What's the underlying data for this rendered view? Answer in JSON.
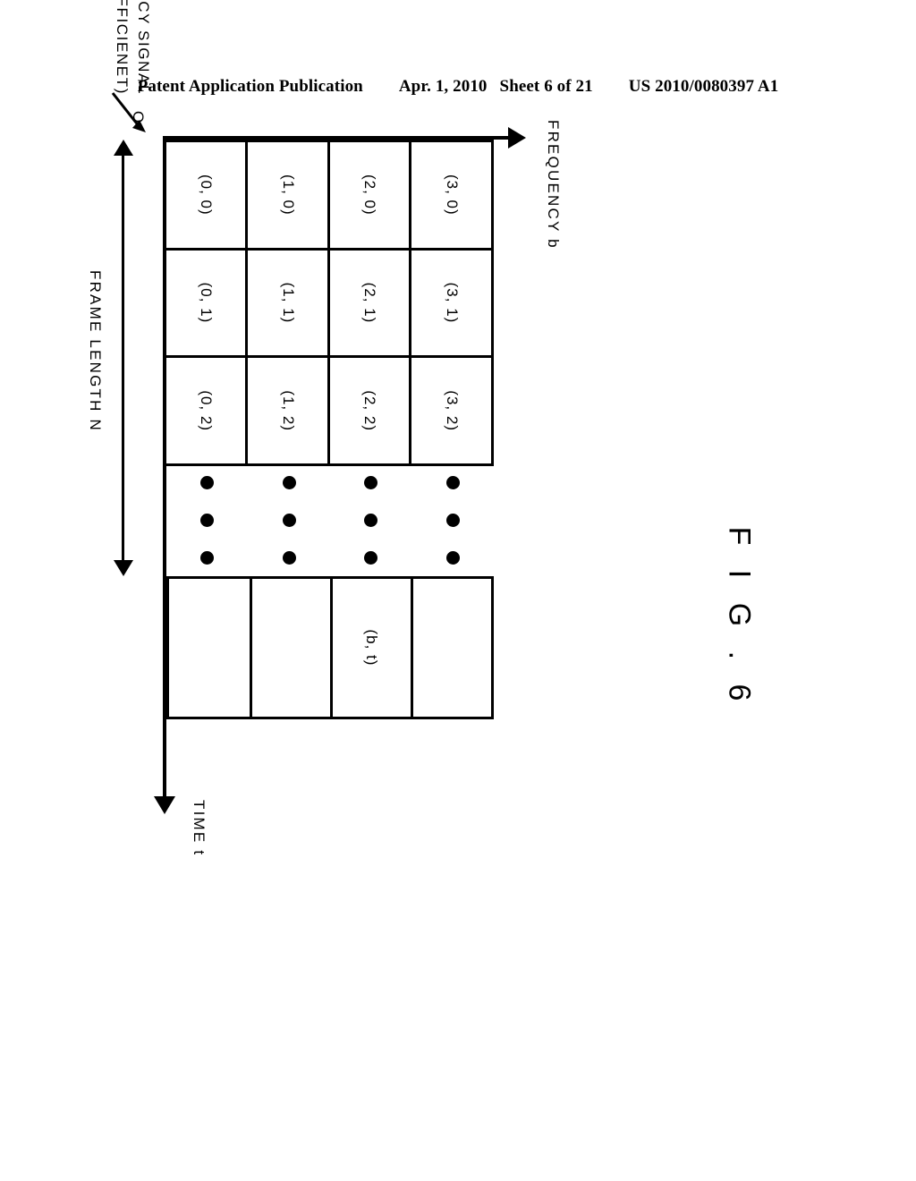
{
  "header": {
    "publication": "Patent Application Publication",
    "date": "Apr. 1, 2010",
    "sheet": "Sheet 6 of 21",
    "patent_number": "US 2010/0080397 A1"
  },
  "figure": {
    "label": "F I G .  6",
    "axes": {
      "time_label": "TIME t",
      "frequency_label": "FREQUENCY b",
      "origin_label": "O",
      "frame_length_label": "FRAME LENGTH N"
    },
    "callout": {
      "line1": "TIME-FREQUENCY SIGNAL",
      "line2": "(QMF COEFFICIENET)"
    },
    "grid": {
      "bands": [
        "3",
        "2",
        "1",
        "0"
      ],
      "time_slots": [
        "0",
        "1",
        "2"
      ],
      "cells": [
        [
          "(3, 0)",
          "(3, 1)",
          "(3, 2)"
        ],
        [
          "(2, 0)",
          "(2, 1)",
          "(2, 2)"
        ],
        [
          "(1, 0)",
          "(1, 1)",
          "(1, 2)"
        ],
        [
          "(0, 0)",
          "(0, 1)",
          "(0, 2)"
        ]
      ],
      "far_column": [
        "",
        "(b, t)",
        "",
        ""
      ],
      "ellipsis_dot_columns": 3,
      "ellipsis_dot_rows": 4
    },
    "colors": {
      "ink": "#000000",
      "background": "#ffffff"
    }
  }
}
